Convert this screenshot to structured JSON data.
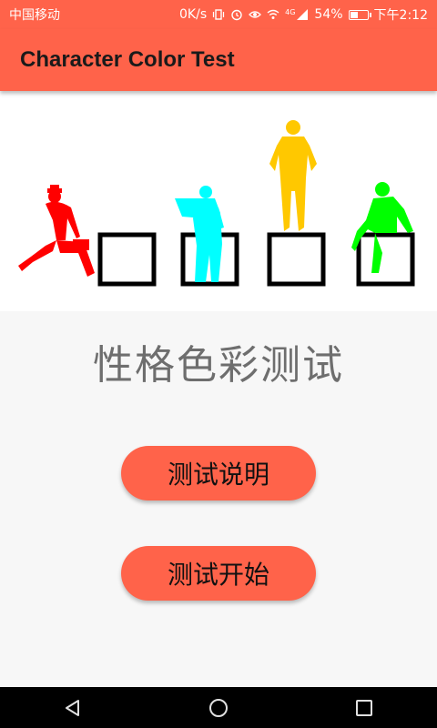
{
  "status_bar": {
    "carrier": "中国移动",
    "speed": "0K/s",
    "network_type": "4G",
    "battery_percent": "54%",
    "battery_level": 0.54,
    "time": "下午2:12"
  },
  "app_bar": {
    "title": "Character Color Test"
  },
  "hero": {
    "figure_colors": {
      "red": "#ff0000",
      "cyan": "#00ffff",
      "yellow": "#ffc800",
      "green": "#00ff00"
    }
  },
  "main": {
    "headline": "性格色彩测试",
    "buttons": {
      "info_label": "测试说明",
      "start_label": "测试开始"
    }
  },
  "colors": {
    "accent": "#ff634a",
    "background": "#f7f7f7"
  },
  "nav_bar": {
    "icons": [
      "back-icon",
      "home-icon",
      "recents-icon"
    ]
  }
}
